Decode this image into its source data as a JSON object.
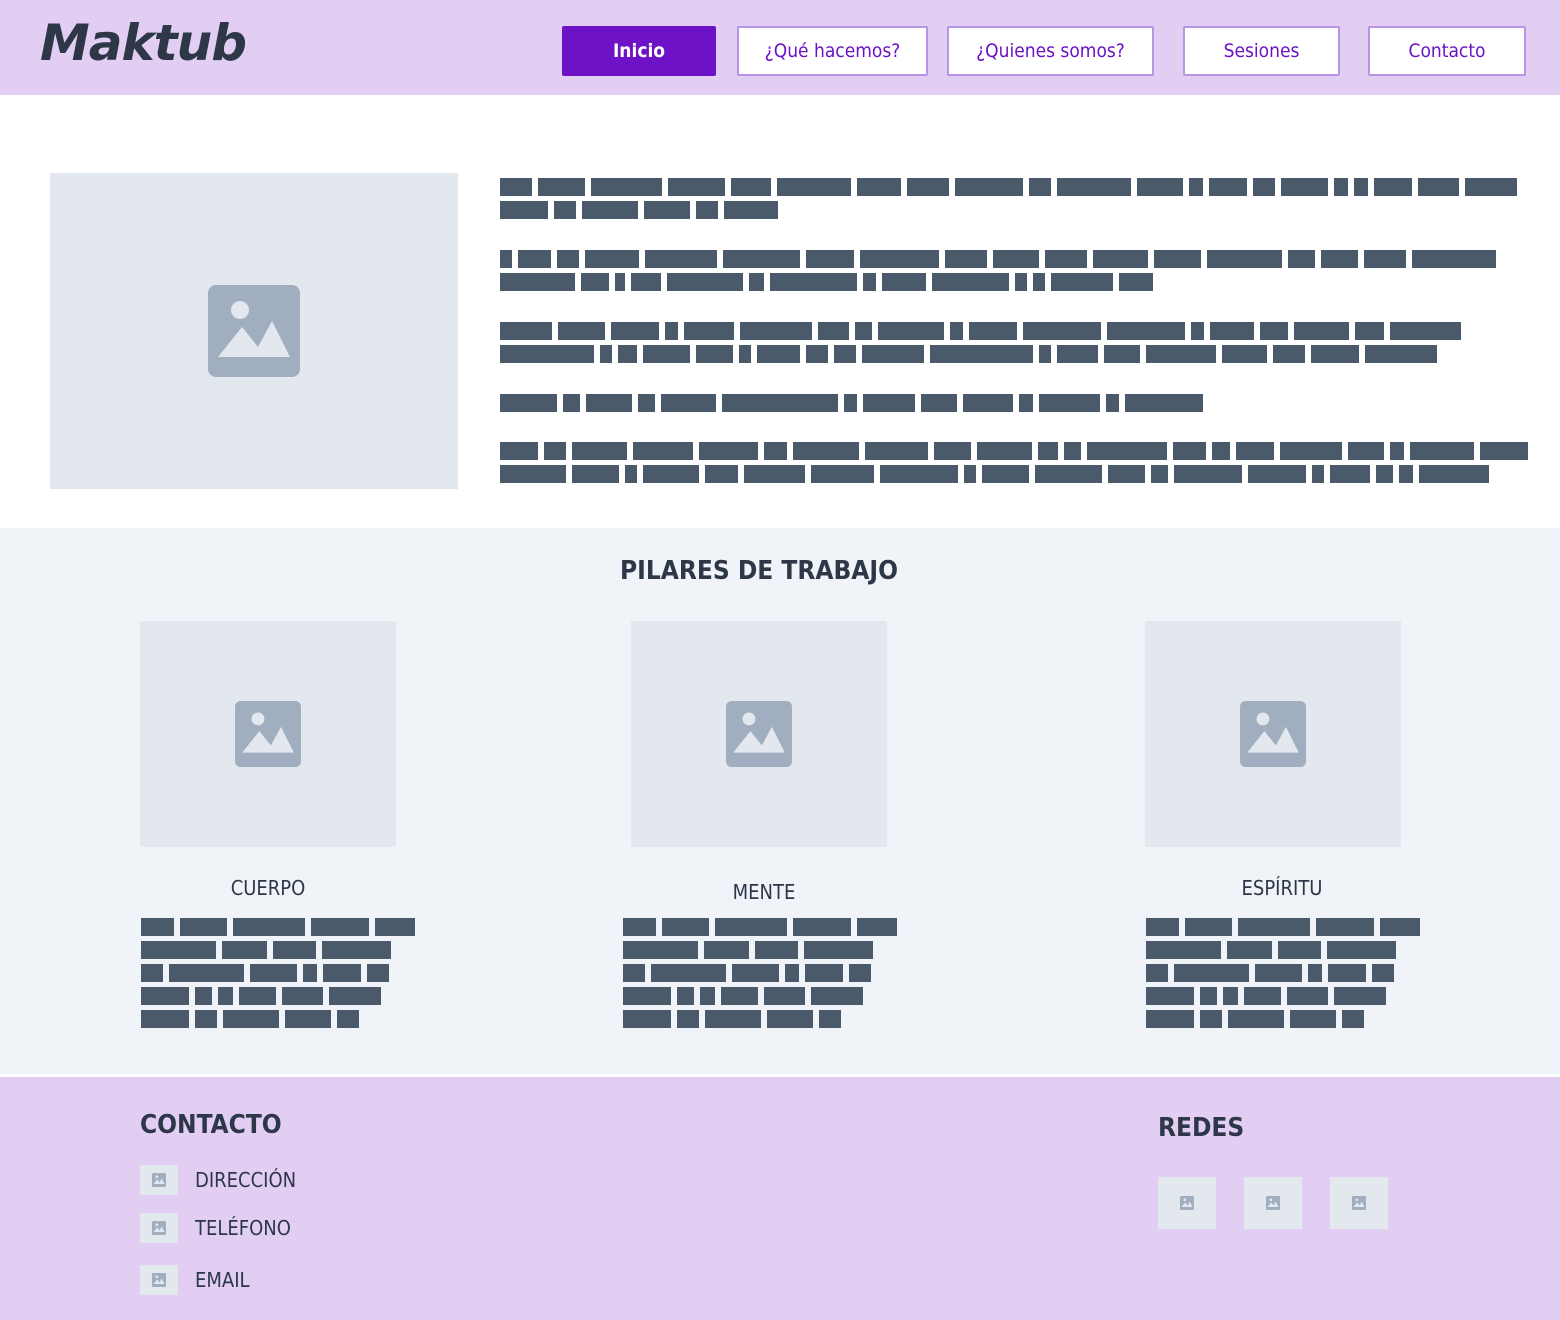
{
  "header": {
    "logo": "Maktub",
    "nav": [
      {
        "label": "Inicio",
        "active": true
      },
      {
        "label": "¿Qué hacemos?",
        "active": false
      },
      {
        "label": "¿Quienes somos?",
        "active": false
      },
      {
        "label": "Sesiones",
        "active": false
      },
      {
        "label": "Contacto",
        "active": false
      }
    ]
  },
  "intro": {
    "image_icon": "image-placeholder-icon"
  },
  "pilares": {
    "title": "PILARES DE TRABAJO",
    "items": [
      {
        "title": "CUERPO",
        "icon": "image-placeholder-icon"
      },
      {
        "title": "MENTE",
        "icon": "image-placeholder-icon"
      },
      {
        "title": "ESPÍRITU",
        "icon": "image-placeholder-icon"
      }
    ]
  },
  "footer": {
    "contact_title": "CONTACTO",
    "contact_items": [
      {
        "label": "DIRECCIÓN",
        "icon": "image-placeholder-icon"
      },
      {
        "label": "TELÉFONO",
        "icon": "image-placeholder-icon"
      },
      {
        "label": "EMAIL",
        "icon": "image-placeholder-icon"
      }
    ],
    "social_title": "REDES",
    "social_icons": [
      "image-placeholder-icon",
      "image-placeholder-icon",
      "image-placeholder-icon"
    ]
  },
  "colors": {
    "header_bg": "#e2cef3",
    "accent": "#6d12c6",
    "placeholder_bg": "#e2e8ee",
    "placeholder_icon": "#a0aec0",
    "text_bar": "#4a5a6b",
    "section_bg": "#f0f4f8"
  }
}
